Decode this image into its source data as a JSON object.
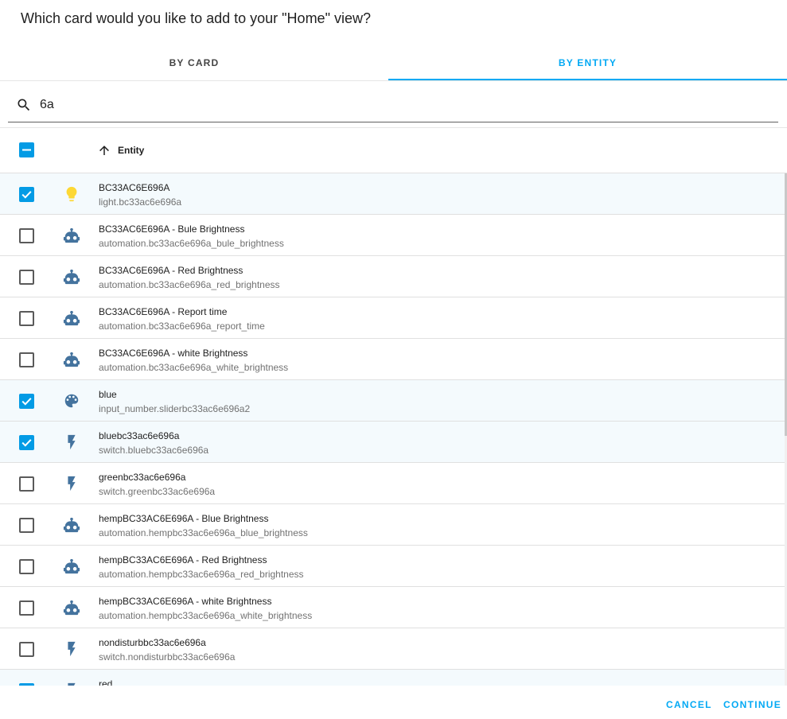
{
  "dialog": {
    "title": "Which card would you like to add to your \"Home\" view?"
  },
  "tabs": [
    {
      "label": "BY CARD",
      "active": false
    },
    {
      "label": "BY ENTITY",
      "active": true
    }
  ],
  "search": {
    "value": "6a"
  },
  "table": {
    "column_header": "Entity",
    "sort": "ascending",
    "rows": [
      {
        "name": "BC33AC6E696A",
        "entity_id": "light.bc33ac6e696a",
        "icon": "lightbulb-icon",
        "selected": true
      },
      {
        "name": "BC33AC6E696A - Bule Brightness",
        "entity_id": "automation.bc33ac6e696a_bule_brightness",
        "icon": "robot-icon",
        "selected": false
      },
      {
        "name": "BC33AC6E696A - Red Brightness",
        "entity_id": "automation.bc33ac6e696a_red_brightness",
        "icon": "robot-icon",
        "selected": false
      },
      {
        "name": "BC33AC6E696A - Report time",
        "entity_id": "automation.bc33ac6e696a_report_time",
        "icon": "robot-icon",
        "selected": false
      },
      {
        "name": "BC33AC6E696A - white Brightness",
        "entity_id": "automation.bc33ac6e696a_white_brightness",
        "icon": "robot-icon",
        "selected": false
      },
      {
        "name": "blue",
        "entity_id": "input_number.sliderbc33ac6e696a2",
        "icon": "palette-icon",
        "selected": true
      },
      {
        "name": "bluebc33ac6e696a",
        "entity_id": "switch.bluebc33ac6e696a",
        "icon": "flash-icon",
        "selected": true
      },
      {
        "name": "greenbc33ac6e696a",
        "entity_id": "switch.greenbc33ac6e696a",
        "icon": "flash-icon",
        "selected": false
      },
      {
        "name": "hempBC33AC6E696A - Blue Brightness",
        "entity_id": "automation.hempbc33ac6e696a_blue_brightness",
        "icon": "robot-icon",
        "selected": false
      },
      {
        "name": "hempBC33AC6E696A - Red Brightness",
        "entity_id": "automation.hempbc33ac6e696a_red_brightness",
        "icon": "robot-icon",
        "selected": false
      },
      {
        "name": "hempBC33AC6E696A - white Brightness",
        "entity_id": "automation.hempbc33ac6e696a_white_brightness",
        "icon": "robot-icon",
        "selected": false
      },
      {
        "name": "nondisturbbc33ac6e696a",
        "entity_id": "switch.nondisturbbc33ac6e696a",
        "icon": "flash-icon",
        "selected": false
      },
      {
        "name": "red",
        "entity_id": "",
        "icon": "flash-icon",
        "selected": true
      }
    ]
  },
  "actions": {
    "cancel_label": "CANCEL",
    "continue_label": "CONTINUE"
  },
  "colors": {
    "accent": "#03a9f4",
    "checkbox": "#039be5",
    "icon": "#44739e",
    "light_on": "#fdd835"
  }
}
